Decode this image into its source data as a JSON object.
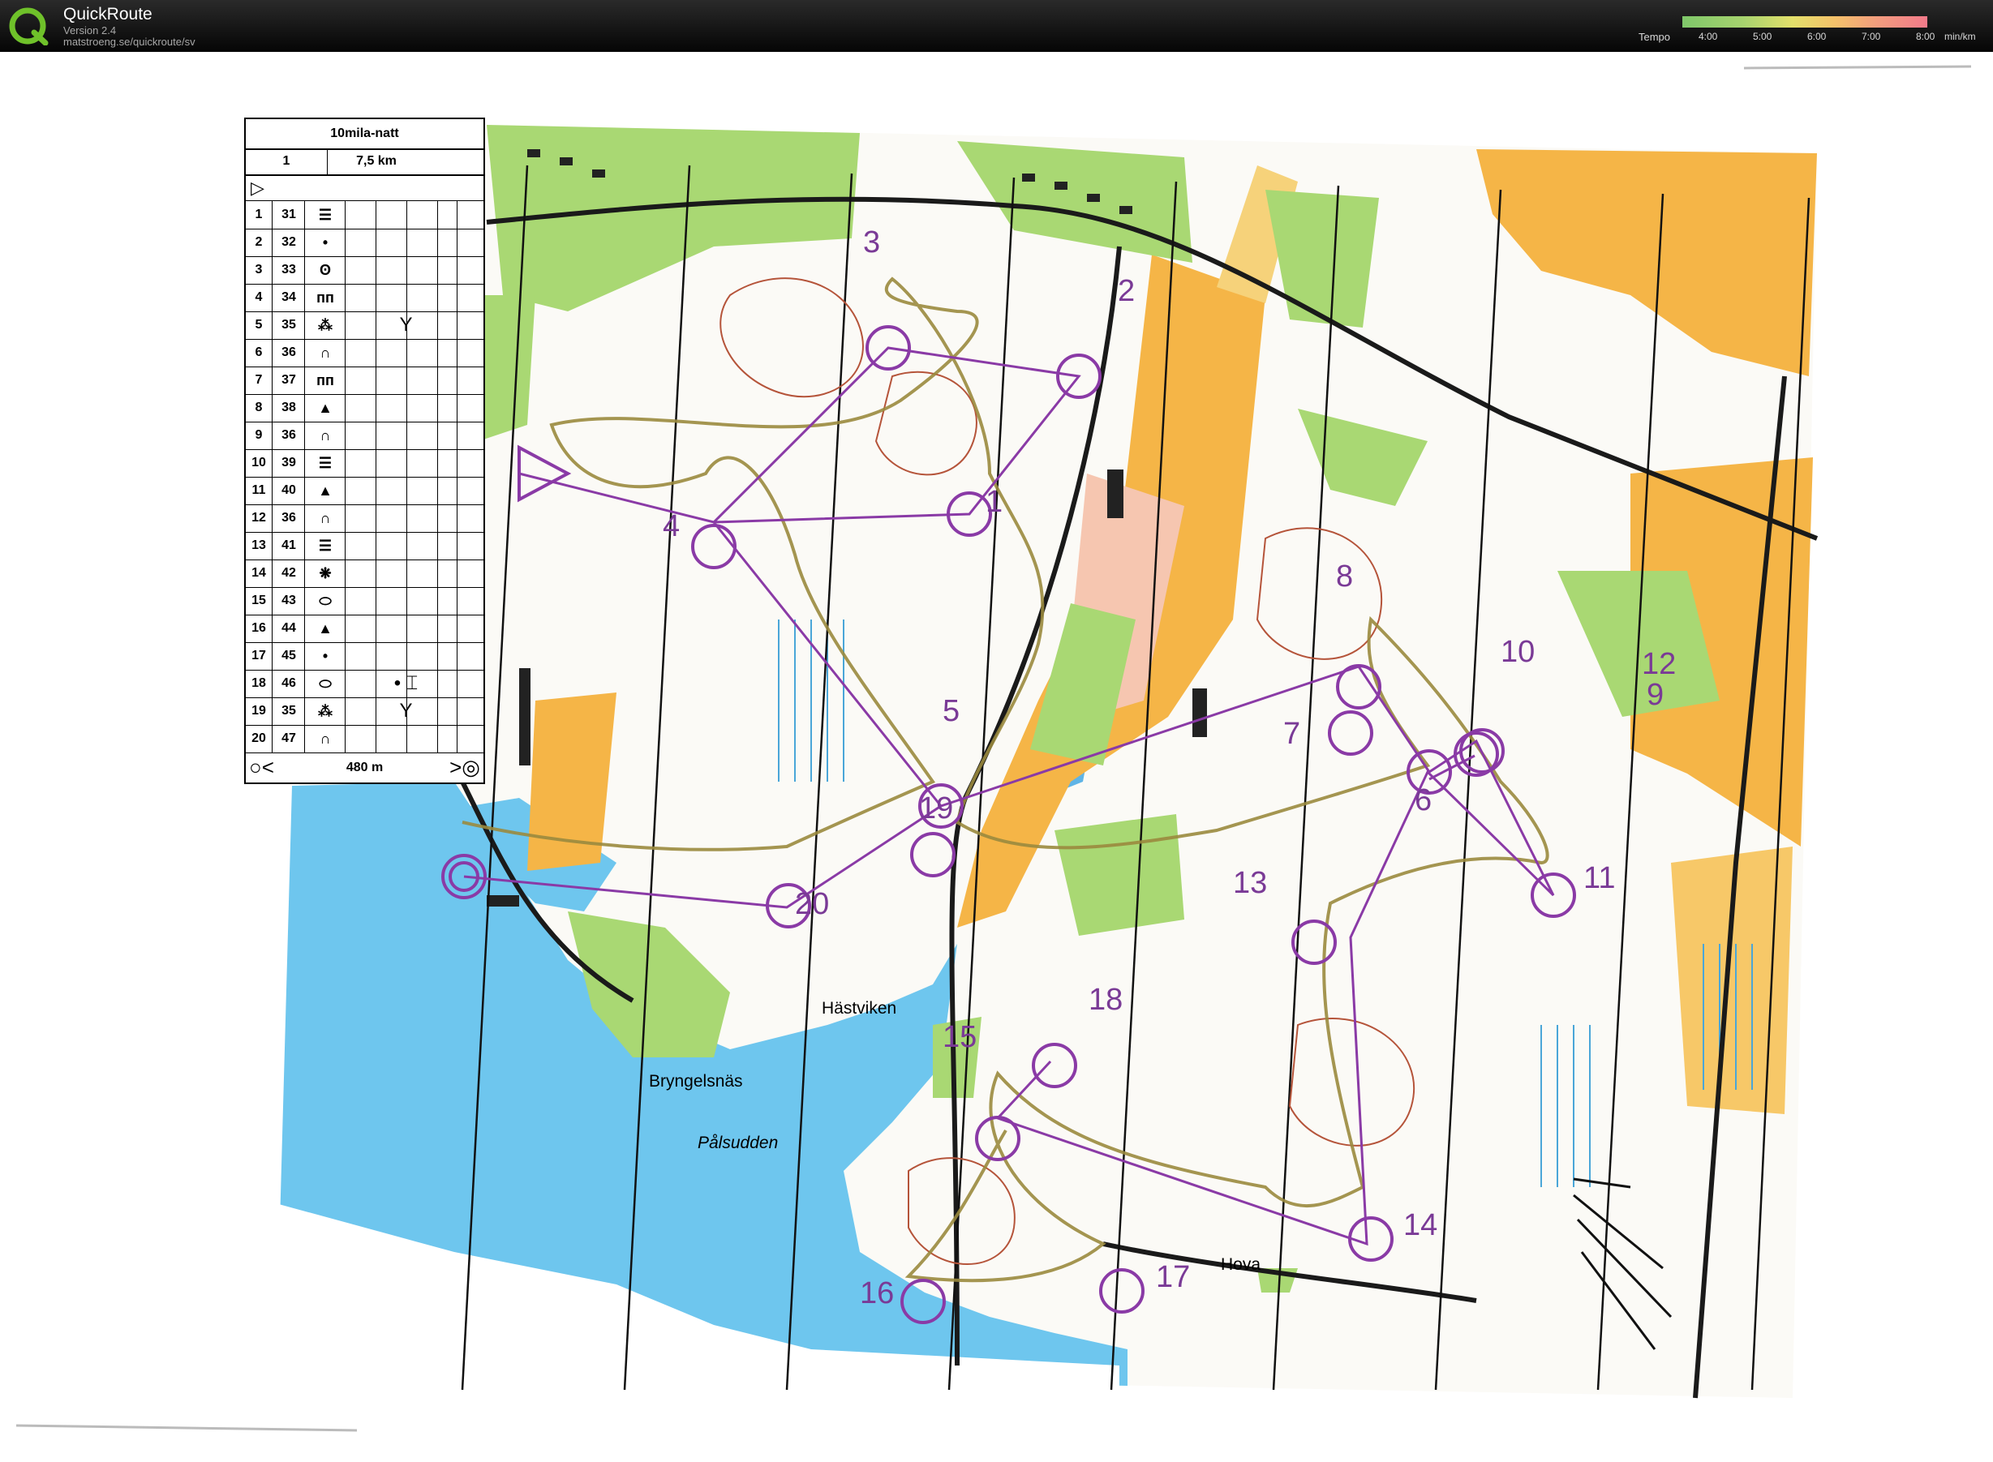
{
  "app": {
    "title": "QuickRoute",
    "version": "Version 2.4",
    "url": "matstroeng.se/quickroute/sv"
  },
  "tempo": {
    "label": "Tempo",
    "ticks": [
      "4:00",
      "5:00",
      "6:00",
      "7:00",
      "8:00"
    ],
    "unit": "min/km",
    "colors": [
      "#7fc86a",
      "#a7d36e",
      "#e3e06b",
      "#f4c26a",
      "#f29c7e",
      "#f27a8a"
    ]
  },
  "colors": {
    "control_purple": "#8a3aa6",
    "water": "#6ec6ee",
    "open_land": "#f5b547",
    "green_vegetation": "#a9d873",
    "route": "#9a8a3e"
  },
  "description_sheet": {
    "title": "10mila-natt",
    "course": "1",
    "length": "7,5 km",
    "start_symbol": "▷",
    "controls": [
      {
        "num": "1",
        "code": "31",
        "symbol": "☰",
        "extra": ""
      },
      {
        "num": "2",
        "code": "32",
        "symbol": "•",
        "extra": ""
      },
      {
        "num": "3",
        "code": "33",
        "symbol": "ʘ",
        "extra": ""
      },
      {
        "num": "4",
        "code": "34",
        "symbol": "ᴨᴨ",
        "extra": ""
      },
      {
        "num": "5",
        "code": "35",
        "symbol": "⁂",
        "extra": "Y"
      },
      {
        "num": "6",
        "code": "36",
        "symbol": "∩",
        "extra": ""
      },
      {
        "num": "7",
        "code": "37",
        "symbol": "ᴨᴨ",
        "extra": ""
      },
      {
        "num": "8",
        "code": "38",
        "symbol": "▲",
        "extra": ""
      },
      {
        "num": "9",
        "code": "36",
        "symbol": "∩",
        "extra": ""
      },
      {
        "num": "10",
        "code": "39",
        "symbol": "☰",
        "extra": ""
      },
      {
        "num": "11",
        "code": "40",
        "symbol": "▲",
        "extra": ""
      },
      {
        "num": "12",
        "code": "36",
        "symbol": "∩",
        "extra": ""
      },
      {
        "num": "13",
        "code": "41",
        "symbol": "☰",
        "extra": ""
      },
      {
        "num": "14",
        "code": "42",
        "symbol": "❋",
        "extra": ""
      },
      {
        "num": "15",
        "code": "43",
        "symbol": "⬭",
        "extra": ""
      },
      {
        "num": "16",
        "code": "44",
        "symbol": "▲",
        "extra": ""
      },
      {
        "num": "17",
        "code": "45",
        "symbol": "•",
        "extra": ""
      },
      {
        "num": "18",
        "code": "46",
        "symbol": "⬭",
        "extra": "•   ⌶"
      },
      {
        "num": "19",
        "code": "35",
        "symbol": "⁂",
        "extra": "Y"
      },
      {
        "num": "20",
        "code": "47",
        "symbol": "∩",
        "extra": ""
      }
    ],
    "finish_distance": "480 m",
    "finish_left_symbol": "○<",
    "finish_right_symbol": ">◎"
  },
  "place_names": {
    "hastviken": "Hästviken",
    "bryngelsnas": "Bryngelsnäs",
    "palsudden": "Pålsudden",
    "hova": "Hova"
  },
  "control_labels": [
    "1",
    "2",
    "3",
    "4",
    "5",
    "6",
    "7",
    "8",
    "9",
    "10",
    "11",
    "12",
    "13",
    "14",
    "15",
    "16",
    "17",
    "18",
    "19",
    "20"
  ]
}
